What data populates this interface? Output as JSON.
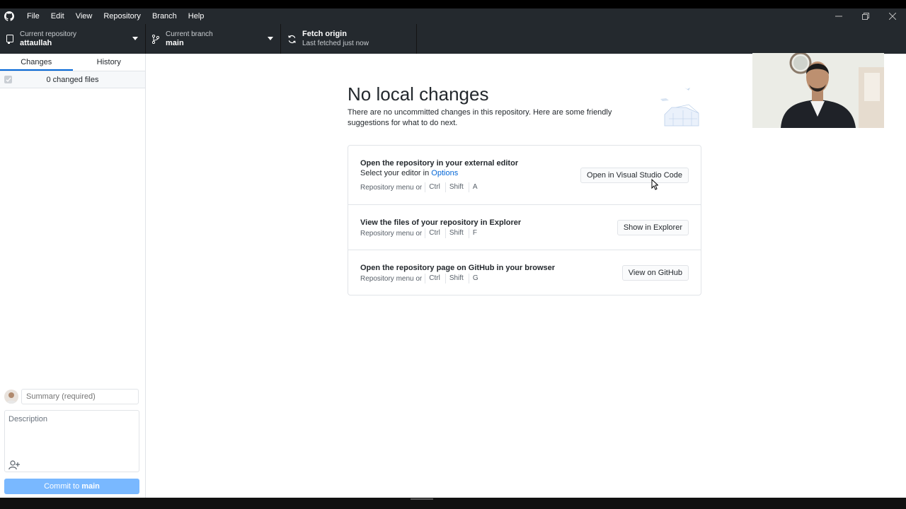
{
  "menu": {
    "items": [
      "File",
      "Edit",
      "View",
      "Repository",
      "Branch",
      "Help"
    ]
  },
  "toolbar": {
    "repo": {
      "label": "Current repository",
      "value": "attaullah"
    },
    "branch": {
      "label": "Current branch",
      "value": "main"
    },
    "fetch": {
      "label": "Fetch origin",
      "value": "Last fetched just now"
    }
  },
  "sidebar": {
    "tabs": [
      "Changes",
      "History"
    ],
    "changed_files": "0 changed files",
    "summary_placeholder": "Summary (required)",
    "description_placeholder": "Description",
    "commit_prefix": "Commit to",
    "commit_branch": "main"
  },
  "main": {
    "title": "No local changes",
    "subtitle": "There are no uncommitted changes in this repository. Here are some friendly suggestions for what to do next.",
    "cards": [
      {
        "title": "Open the repository in your external editor",
        "sub_prefix": "Select your editor in",
        "sub_link": "Options",
        "shortcut_prefix": "Repository menu or",
        "keys": [
          "Ctrl",
          "Shift",
          "A"
        ],
        "button": "Open in Visual Studio Code"
      },
      {
        "title": "View the files of your repository in Explorer",
        "shortcut_prefix": "Repository menu or",
        "keys": [
          "Ctrl",
          "Shift",
          "F"
        ],
        "button": "Show in Explorer"
      },
      {
        "title": "Open the repository page on GitHub in your browser",
        "shortcut_prefix": "Repository menu or",
        "keys": [
          "Ctrl",
          "Shift",
          "G"
        ],
        "button": "View on GitHub"
      }
    ]
  },
  "colors": {
    "titlebar": "#24292e",
    "accent": "#0366d6",
    "commit_button": "#79b8ff"
  }
}
